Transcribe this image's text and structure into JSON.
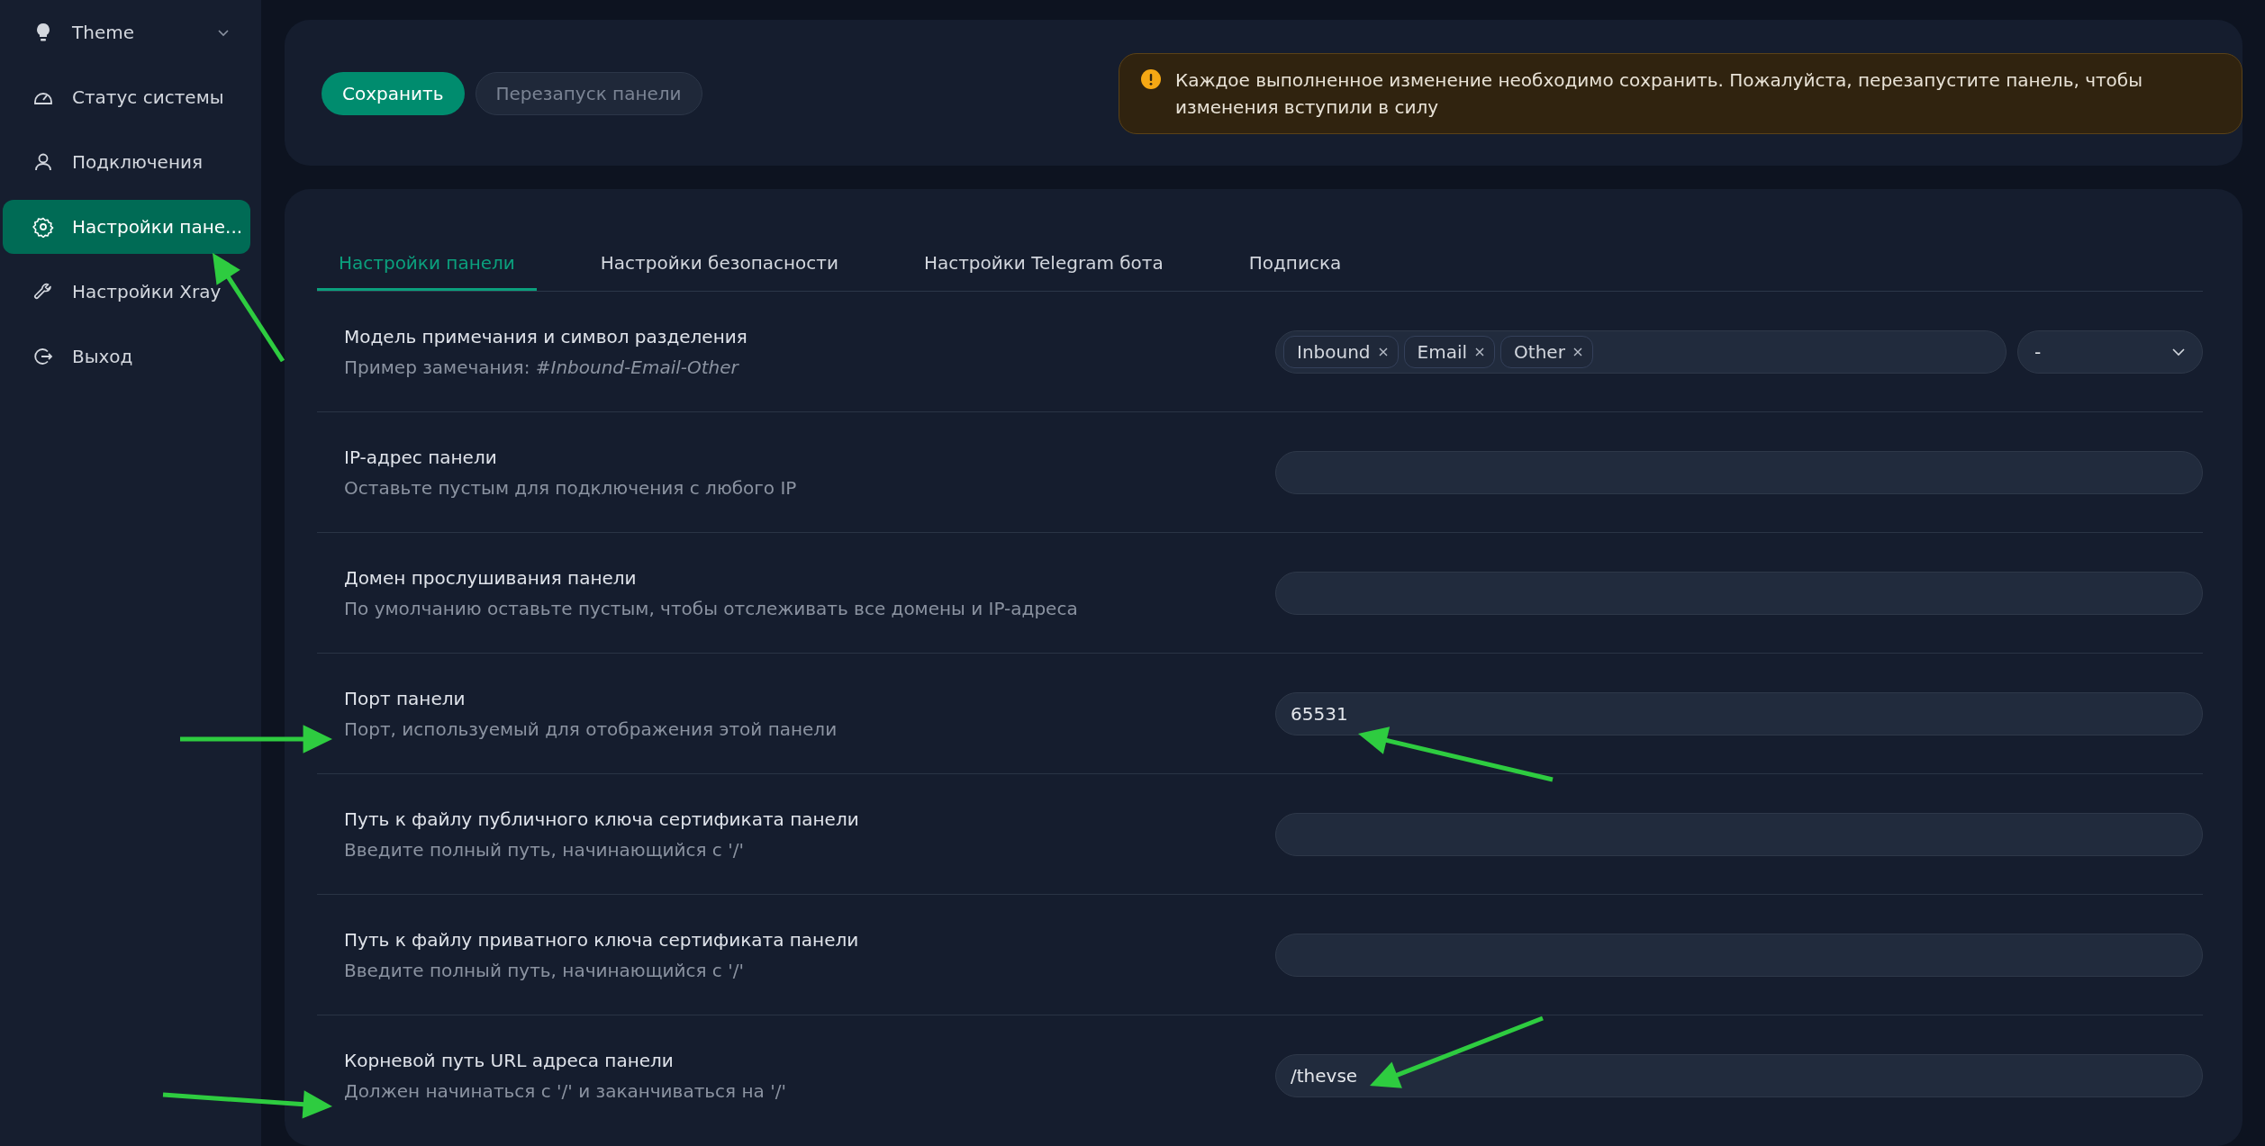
{
  "sidebar": {
    "items": [
      {
        "kind": "submenu",
        "label": "Theme",
        "selected": false,
        "expanded": false
      },
      {
        "kind": "link",
        "label": "Статус системы",
        "selected": false
      },
      {
        "kind": "link",
        "label": "Подключения",
        "selected": false
      },
      {
        "kind": "link",
        "label": "Настройки пане...",
        "selected": true
      },
      {
        "kind": "link",
        "label": "Настройки Xray",
        "selected": false
      },
      {
        "kind": "link",
        "label": "Выход",
        "selected": false
      }
    ]
  },
  "toolbar": {
    "save_button": "Сохранить",
    "restart_button": {
      "label": "Перезапуск панели",
      "disabled": true
    },
    "alert": "Каждое выполненное изменение необходимо сохранить. Пожалуйста, перезапустите панель, чтобы изменения вступили в силу"
  },
  "tabs": [
    {
      "label": "Настройки панели",
      "selected": true
    },
    {
      "label": "Настройки безопасности",
      "selected": false
    },
    {
      "label": "Настройки Telegram бота",
      "selected": false
    },
    {
      "label": "Подписка",
      "selected": false
    }
  ],
  "settings": [
    {
      "kind": "tags",
      "label": "Модель примечания и символ разделения",
      "description": "Пример замечания: *#Inbound-Email-Other*",
      "tags": [
        "Inbound",
        "Email",
        "Other"
      ],
      "select": "-"
    },
    {
      "kind": "input",
      "label": "IP-адрес панели",
      "description": "Оставьте пустым для подключения с любого IP"
    },
    {
      "kind": "input",
      "label": "Домен прослушивания панели",
      "description": "По умолчанию оставьте пустым, чтобы отслеживать все домены и IP-адреса"
    },
    {
      "kind": "input",
      "label": "Порт панели",
      "description": "Порт, используемый для отображения этой панели",
      "value": "65531"
    },
    {
      "kind": "input",
      "label": "Путь к файлу публичного ключа сертификата панели",
      "description": "Введите полный путь, начинающийся с '/'"
    },
    {
      "kind": "input",
      "label": "Путь к файлу приватного ключа сертификата панели",
      "description": "Введите полный путь, начинающийся с '/'"
    },
    {
      "kind": "input",
      "label": "Корневой путь URL адреса панели",
      "description": "Должен начинаться с '/' и заканчиваться на '/'",
      "value": "/thevse"
    }
  ]
}
